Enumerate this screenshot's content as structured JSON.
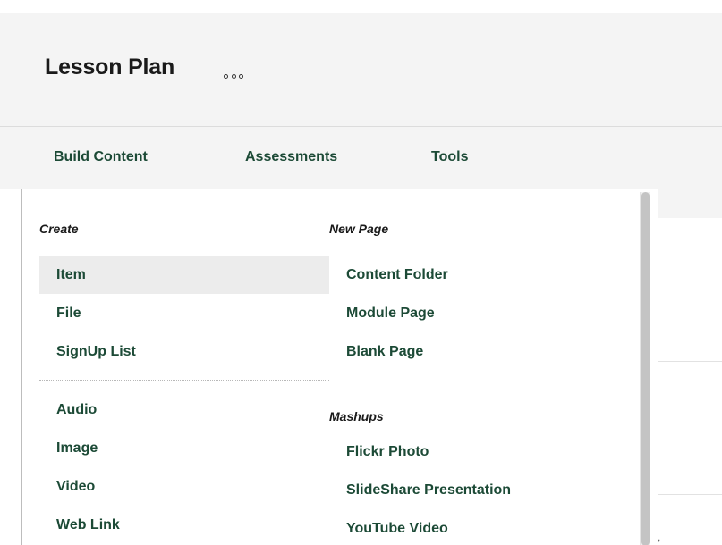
{
  "header": {
    "title": "Lesson Plan"
  },
  "tabs": [
    {
      "label": "Build Content"
    },
    {
      "label": "Assessments"
    },
    {
      "label": "Tools"
    }
  ],
  "dropdown": {
    "left": {
      "heading": "Create",
      "items": [
        {
          "label": "Item",
          "highlighted": true
        },
        {
          "label": "File"
        },
        {
          "label": "SignUp List"
        },
        {
          "label": "Audio"
        },
        {
          "label": "Image"
        },
        {
          "label": "Video"
        },
        {
          "label": "Web Link"
        }
      ]
    },
    "right": {
      "new_page_heading": "New Page",
      "new_page_items": [
        {
          "label": "Content Folder"
        },
        {
          "label": "Module Page"
        },
        {
          "label": "Blank Page"
        }
      ],
      "mashups_heading": "Mashups",
      "mashups_items": [
        {
          "label": "Flickr Photo"
        },
        {
          "label": "SlideShare Presentation"
        },
        {
          "label": "YouTube Video"
        }
      ]
    }
  },
  "background": {
    "fragment": ","
  },
  "colors": {
    "link": "#1c4a36",
    "header_bg": "#f4f4f4",
    "highlight": "#ececec"
  },
  "icons": {
    "more": "more-options-icon"
  }
}
